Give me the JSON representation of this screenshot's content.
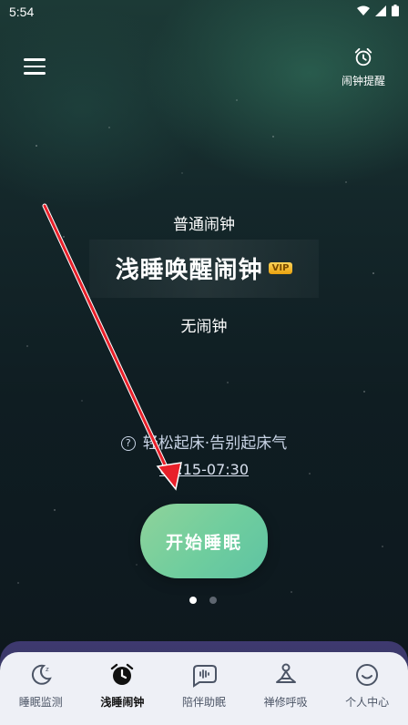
{
  "status_bar": {
    "time": "5:54"
  },
  "header": {
    "alarm_reminder_label": "闹钟提醒"
  },
  "modes": {
    "normal": "普通闹钟",
    "active": "浅睡唤醒闹钟",
    "vip_badge": "VIP",
    "none": "无闹钟"
  },
  "tip": {
    "text": "轻松起床·告别起床气"
  },
  "time_range": "07:15-07:30",
  "start_button": "开始睡眠",
  "pager": {
    "count": 2,
    "active_index": 0
  },
  "tabs": [
    {
      "label": "睡眠监测",
      "icon": "moon-icon",
      "active": false
    },
    {
      "label": "浅睡闹钟",
      "icon": "alarm-clock-icon",
      "active": true
    },
    {
      "label": "陪伴助眠",
      "icon": "sound-wave-icon",
      "active": false
    },
    {
      "label": "禅修呼吸",
      "icon": "meditation-icon",
      "active": false
    },
    {
      "label": "个人中心",
      "icon": "smiley-icon",
      "active": false
    }
  ],
  "colors": {
    "start_button": "#6fcd9e",
    "annotation_arrow": "#e8202a",
    "vip_badge": "#f0b020"
  }
}
